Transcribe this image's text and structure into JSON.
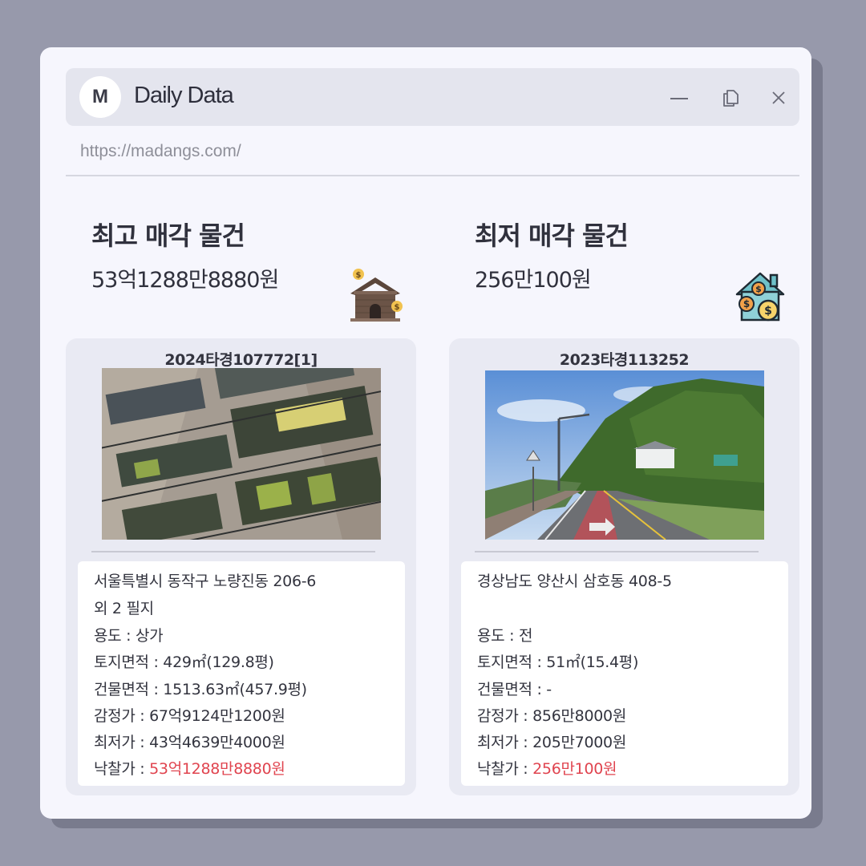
{
  "window": {
    "logo_letter": "M",
    "title": "Daily Data",
    "url": "https://madangs.com/"
  },
  "highest": {
    "heading": "최고 매각 물건",
    "price": "53억1288만8880원",
    "case_number": "2024타경107772[1]",
    "address_line1": "서울특별시 동작구 노량진동 206-6",
    "address_line2": "외 2 필지",
    "usage": "용도 : 상가",
    "land_area": "토지면적 : 429㎡(129.8평)",
    "building_area": "건물면적 : 1513.63㎡(457.9평)",
    "appraisal": "감정가 : 67억9124만1200원",
    "minimum": "최저가 : 43억4639만4000원",
    "winning_label": "낙찰가 : ",
    "winning_value": "53억1288만8880원"
  },
  "lowest": {
    "heading": "최저 매각 물건",
    "price": "256만100원",
    "case_number": "2023타경113252",
    "address_line1": "경상남도 양산시 삼호동 408-5",
    "usage": "용도 :  전",
    "land_area": "토지면적 : 51㎡(15.4평)",
    "building_area": "건물면적 : -",
    "appraisal": "감정가 : 856만8000원",
    "minimum": "최저가 : 205만7000원",
    "winning_label": "낙찰가 : ",
    "winning_value": "256만100원"
  },
  "icons": {
    "minimize": "minimize-icon",
    "restore": "restore-icon",
    "close": "close-icon",
    "highest": "house-money-icon",
    "lowest": "house-coins-icon"
  },
  "colors": {
    "background": "#9799ab",
    "window": "#f6f6fd",
    "titlebar": "#e4e5ee",
    "card": "#e9eaf3",
    "accent_red": "#e0444f"
  }
}
